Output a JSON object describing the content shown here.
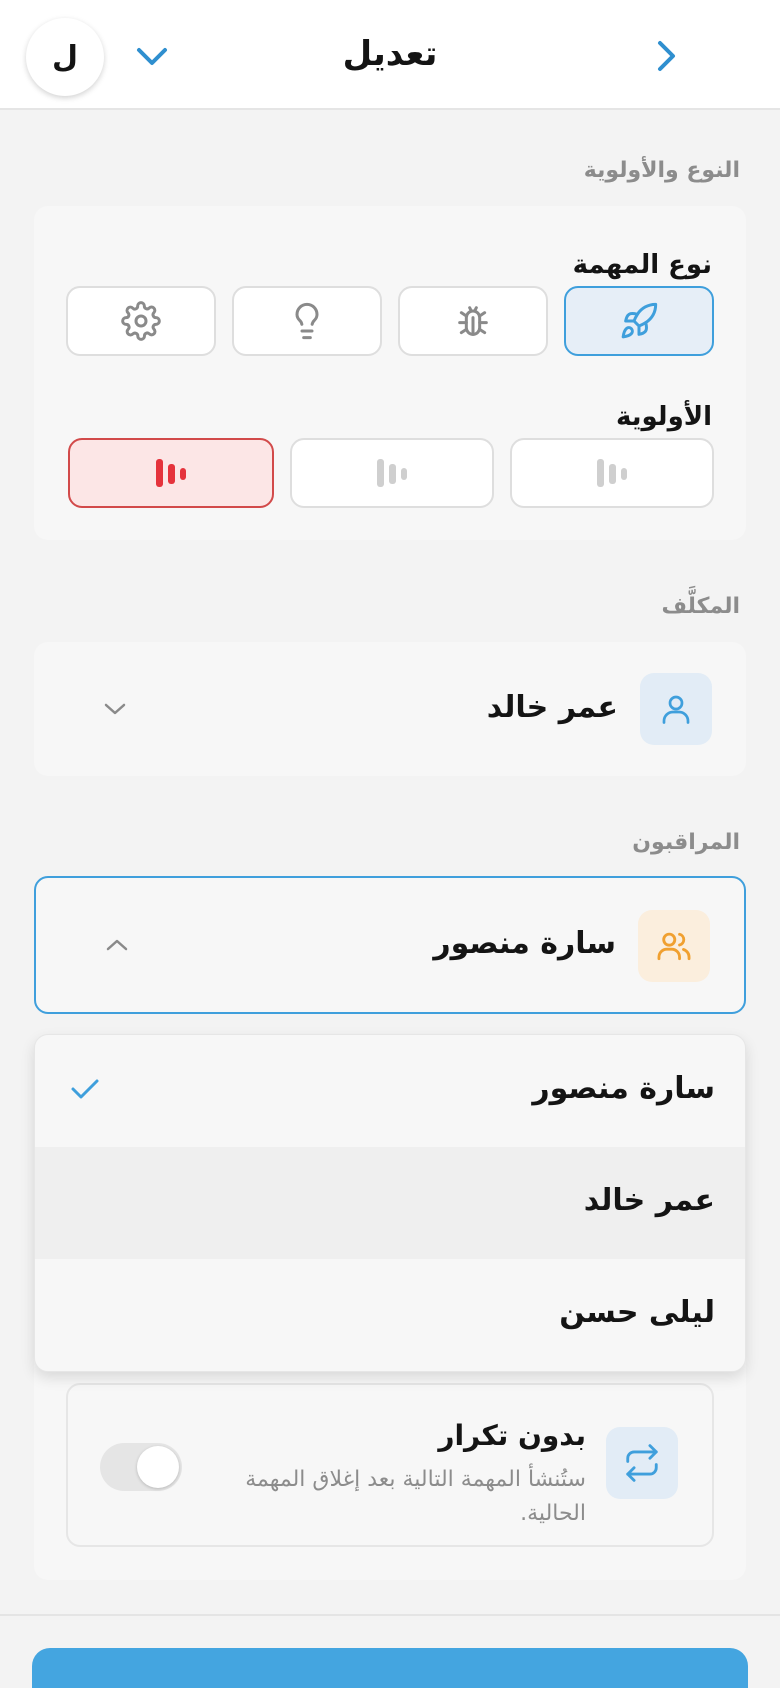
{
  "header": {
    "title": "تعديل",
    "avatar_initial": "ل",
    "back_icon": "chevron-right-icon",
    "collapse_icon": "chevron-down-icon"
  },
  "type_priority": {
    "section_label": "النوع والأولوية",
    "task_type_label": "نوع المهمة",
    "task_types": [
      {
        "icon": "rocket-icon",
        "selected": true
      },
      {
        "icon": "bug-icon",
        "selected": false
      },
      {
        "icon": "lightbulb-icon",
        "selected": false
      },
      {
        "icon": "gear-icon",
        "selected": false
      }
    ],
    "priority_label": "الأولوية",
    "priorities": [
      {
        "icon": "priority-low-icon",
        "level": 1,
        "selected": false
      },
      {
        "icon": "priority-medium-icon",
        "level": 2,
        "selected": false
      },
      {
        "icon": "priority-high-icon",
        "level": 3,
        "selected": true
      }
    ]
  },
  "assignee": {
    "section_label": "المكلَّف",
    "value": "عمر خالد",
    "icon": "user-icon"
  },
  "watchers": {
    "section_label": "المراقبون",
    "value": "سارة منصور",
    "icon": "users-icon",
    "options": [
      {
        "label": "سارة منصور",
        "checked": true
      },
      {
        "label": "عمر خالد",
        "checked": false
      },
      {
        "label": "ليلى حسن",
        "checked": false
      }
    ]
  },
  "repeat": {
    "title": "بدون تكرار",
    "description": "ستُنشأ المهمة التالية بعد إغلاق المهمة الحالية.",
    "icon": "repeat-icon",
    "enabled": false
  },
  "colors": {
    "accent": "#3f9fdc",
    "priority_high": "#e5333c",
    "watchers_icon": "#f0a030"
  }
}
